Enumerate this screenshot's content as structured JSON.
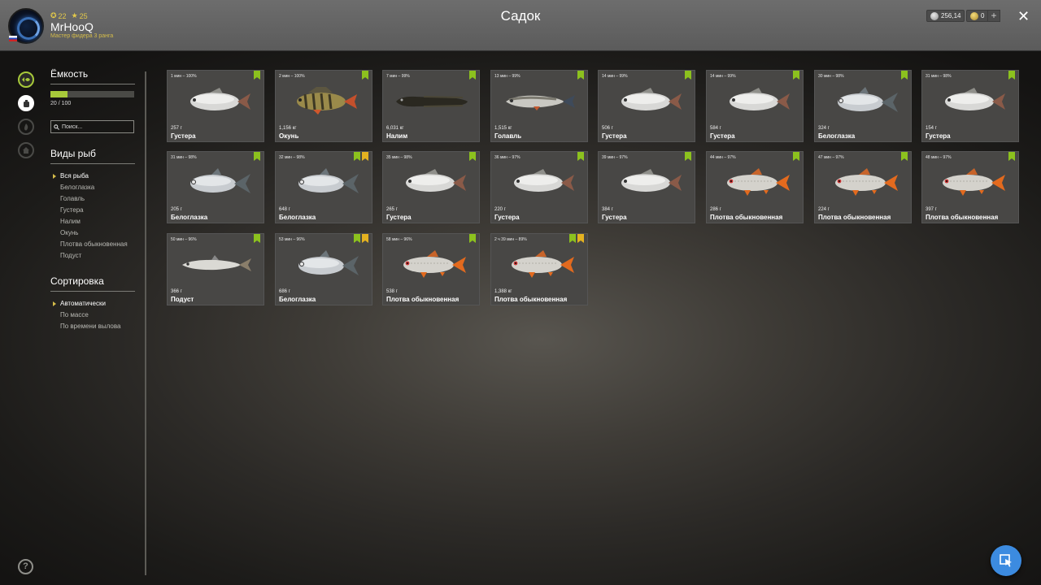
{
  "header": {
    "title": "Садок",
    "player": {
      "name": "MrHooQ",
      "rank": "Мастер фидера 3 ранга",
      "coins_level": "22",
      "stars": "25"
    },
    "currency_silver": "256,14",
    "currency_gold": "0",
    "add_label": "+",
    "close_label": "✕"
  },
  "sidebar": {
    "capacity_title": "Ёмкость",
    "capacity_text": "20 / 100",
    "capacity_fraction": 0.2,
    "search_placeholder": "Поиск...",
    "species_title": "Виды рыб",
    "species": [
      "Вся рыба",
      "Белоглазка",
      "Голавль",
      "Густера",
      "Налим",
      "Окунь",
      "Плотва обыкновенная",
      "Подуст"
    ],
    "sort_title": "Сортировка",
    "sort_options": [
      "Автоматически",
      "По массе",
      "По времени вылова"
    ],
    "help_label": "?"
  },
  "fish": [
    {
      "meta": "1 мин – 100%",
      "weight": "257 г",
      "name": "Густера",
      "kind": "bream",
      "badges": [
        "green"
      ]
    },
    {
      "meta": "2 мин – 100%",
      "weight": "1,156 кг",
      "name": "Окунь",
      "kind": "perch",
      "badges": [
        "green"
      ]
    },
    {
      "meta": "7 мин – 99%",
      "weight": "6,031 кг",
      "name": "Налим",
      "kind": "burbot",
      "badges": [
        "green"
      ]
    },
    {
      "meta": "13 мин – 99%",
      "weight": "1,515 кг",
      "name": "Голавль",
      "kind": "chub",
      "badges": [
        "green"
      ]
    },
    {
      "meta": "14 мин – 99%",
      "weight": "506 г",
      "name": "Густера",
      "kind": "bream",
      "badges": [
        "green"
      ]
    },
    {
      "meta": "14 мин – 99%",
      "weight": "584 г",
      "name": "Густера",
      "kind": "bream",
      "badges": [
        "green"
      ]
    },
    {
      "meta": "30 мин – 98%",
      "weight": "324 г",
      "name": "Белоглазка",
      "kind": "whiteeye",
      "badges": [
        "green"
      ]
    },
    {
      "meta": "31 мин – 98%",
      "weight": "154 г",
      "name": "Густера",
      "kind": "bream",
      "badges": [
        "green"
      ]
    },
    {
      "meta": "31 мин – 98%",
      "weight": "205 г",
      "name": "Белоглазка",
      "kind": "whiteeye",
      "badges": [
        "green"
      ]
    },
    {
      "meta": "32 мин – 98%",
      "weight": "648 г",
      "name": "Белоглазка",
      "kind": "whiteeye",
      "badges": [
        "green",
        "gold"
      ]
    },
    {
      "meta": "35 мин – 98%",
      "weight": "265 г",
      "name": "Густера",
      "kind": "bream",
      "badges": [
        "green"
      ]
    },
    {
      "meta": "36 мин – 97%",
      "weight": "220 г",
      "name": "Густера",
      "kind": "bream",
      "badges": [
        "green"
      ]
    },
    {
      "meta": "39 мин – 97%",
      "weight": "384 г",
      "name": "Густера",
      "kind": "bream",
      "badges": [
        "green"
      ]
    },
    {
      "meta": "44 мин – 97%",
      "weight": "286 г",
      "name": "Плотва обыкновенная",
      "kind": "roach",
      "badges": [
        "green"
      ]
    },
    {
      "meta": "47 мин – 97%",
      "weight": "224 г",
      "name": "Плотва обыкновенная",
      "kind": "roach",
      "badges": [
        "green"
      ]
    },
    {
      "meta": "48 мин – 97%",
      "weight": "397 г",
      "name": "Плотва обыкновенная",
      "kind": "roach",
      "badges": [
        "green"
      ]
    },
    {
      "meta": "50 мин – 96%",
      "weight": "366 г",
      "name": "Подуст",
      "kind": "nase",
      "badges": [
        "green"
      ]
    },
    {
      "meta": "53 мин – 96%",
      "weight": "686 г",
      "name": "Белоглазка",
      "kind": "whiteeye",
      "badges": [
        "green",
        "gold"
      ]
    },
    {
      "meta": "58 мин – 96%",
      "weight": "538 г",
      "name": "Плотва обыкновенная",
      "kind": "roach",
      "badges": [
        "green"
      ]
    },
    {
      "meta": "2 ч 39 мин – 89%",
      "weight": "1,388 кг",
      "name": "Плотва обыкновенная",
      "kind": "roach",
      "badges": [
        "green",
        "gold"
      ]
    }
  ]
}
